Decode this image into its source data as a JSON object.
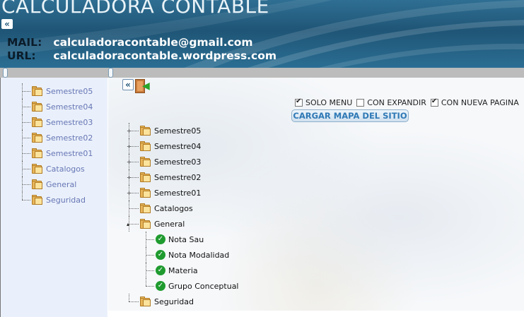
{
  "header": {
    "title": "CALCULADORA CONTABLE",
    "collapse_icon": "double-chevron-left-icon",
    "mail_label": "MAIL:",
    "mail_value": "calculadoracontable@gmail.com",
    "url_label": "URL:",
    "url_value": "calculadoracontable.wordpress.com"
  },
  "sidebar": {
    "items": [
      {
        "label": "Semestre05",
        "icon": "folder-icon"
      },
      {
        "label": "Semestre04",
        "icon": "folder-icon"
      },
      {
        "label": "Semestre03",
        "icon": "folder-icon"
      },
      {
        "label": "Semestre02",
        "icon": "folder-icon"
      },
      {
        "label": "Semestre01",
        "icon": "folder-icon"
      },
      {
        "label": "Catalogos",
        "icon": "folder-icon"
      },
      {
        "label": "General",
        "icon": "folder-icon"
      },
      {
        "label": "Seguridad",
        "icon": "folder-icon"
      }
    ]
  },
  "toolbar": {
    "collapse_icon": "double-chevron-left-icon",
    "exit_icon": "exit-door-icon"
  },
  "options": {
    "solo_menu": {
      "label": "SOLO MENU",
      "checked": true
    },
    "con_expandir": {
      "label": "CON EXPANDIR",
      "checked": false
    },
    "con_nueva_pagina": {
      "label": "CON NUEVA PAGINA",
      "checked": true
    },
    "load_button": "CARGAR MAPA DEL SITIO"
  },
  "tree": {
    "nodes": [
      {
        "label": "Semestre05"
      },
      {
        "label": "Semestre04"
      },
      {
        "label": "Semestre03"
      },
      {
        "label": "Semestre02"
      },
      {
        "label": "Semestre01"
      },
      {
        "label": "Catalogos"
      },
      {
        "label": "General",
        "expanded": true,
        "children": [
          {
            "label": "Nota Sau"
          },
          {
            "label": "Nota Modalidad"
          },
          {
            "label": "Materia"
          },
          {
            "label": "Grupo Conceptual"
          }
        ]
      },
      {
        "label": "Seguridad"
      }
    ]
  },
  "colors": {
    "header_bg": "#1f5576",
    "sidebar_bg": "#eaf0fb",
    "sidebar_link": "#6676b5",
    "button_text": "#2f79b6",
    "check_green": "#1f9b2f"
  }
}
